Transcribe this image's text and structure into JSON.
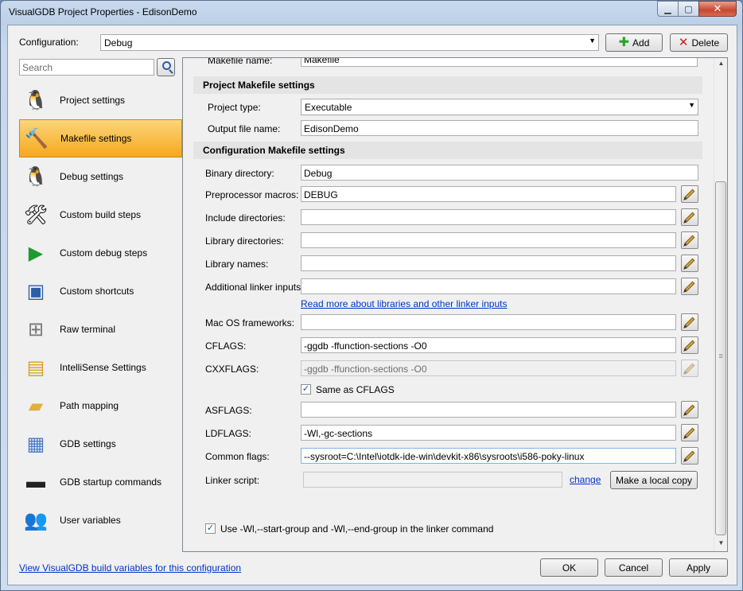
{
  "window": {
    "title": "VisualGDB Project Properties - EdisonDemo"
  },
  "config": {
    "label": "Configuration:",
    "value": "Debug",
    "add_label": "Add",
    "delete_label": "Delete"
  },
  "search": {
    "placeholder": "Search"
  },
  "sidebar": {
    "items": [
      {
        "label": "Project settings",
        "icon": "tux-icon"
      },
      {
        "label": "Makefile settings",
        "icon": "hammer-icon",
        "active": true
      },
      {
        "label": "Debug settings",
        "icon": "tux-debug-icon"
      },
      {
        "label": "Custom build steps",
        "icon": "tools-icon"
      },
      {
        "label": "Custom debug steps",
        "icon": "tools-play-icon"
      },
      {
        "label": "Custom shortcuts",
        "icon": "window-shortcut-icon"
      },
      {
        "label": "Raw terminal",
        "icon": "serial-port-icon"
      },
      {
        "label": "IntelliSense Settings",
        "icon": "intellisense-icon"
      },
      {
        "label": "Path mapping",
        "icon": "folders-icon"
      },
      {
        "label": "GDB settings",
        "icon": "document-icon"
      },
      {
        "label": "GDB startup commands",
        "icon": "terminal-icon"
      },
      {
        "label": "User variables",
        "icon": "user-variables-icon"
      }
    ]
  },
  "panel": {
    "partial_label": "Makefile name:",
    "partial_value": "Makefile",
    "project_section": "Project Makefile settings",
    "project_type_label": "Project type:",
    "project_type_value": "Executable",
    "output_label": "Output file name:",
    "output_value": "EdisonDemo",
    "config_section": "Configuration Makefile settings",
    "binary_label": "Binary directory:",
    "binary_value": "Debug",
    "macros_label": "Preprocessor macros:",
    "macros_value": "DEBUG",
    "include_label": "Include directories:",
    "include_value": "",
    "libdir_label": "Library directories:",
    "libdir_value": "",
    "libnames_label": "Library names:",
    "libnames_value": "",
    "addlinker_label": "Additional linker inputs:",
    "addlinker_value": "",
    "readmore_link": "Read more about libraries and other linker inputs",
    "macos_label": "Mac OS frameworks:",
    "macos_value": "",
    "cflags_label": "CFLAGS:",
    "cflags_value": "-ggdb -ffunction-sections -O0",
    "cxxflags_label": "CXXFLAGS:",
    "cxxflags_value": "-ggdb -ffunction-sections -O0",
    "same_as_cflags": "Same as CFLAGS",
    "asflags_label": "ASFLAGS:",
    "asflags_value": "",
    "ldflags_label": "LDFLAGS:",
    "ldflags_value": "-Wl,-gc-sections",
    "common_label": "Common flags:",
    "common_value": "--sysroot=C:\\Intel\\iotdk-ide-win\\devkit-x86\\sysroots\\i586-poky-linux",
    "linker_script_label": "Linker script:",
    "linker_script_value": "",
    "change_link": "change",
    "local_copy_label": "Make a local copy",
    "group_label": "Use -Wl,--start-group and -Wl,--end-group in the linker command"
  },
  "footer": {
    "vars_link": "View VisualGDB build variables for this configuration",
    "ok_label": "OK",
    "cancel_label": "Cancel",
    "apply_label": "Apply"
  }
}
